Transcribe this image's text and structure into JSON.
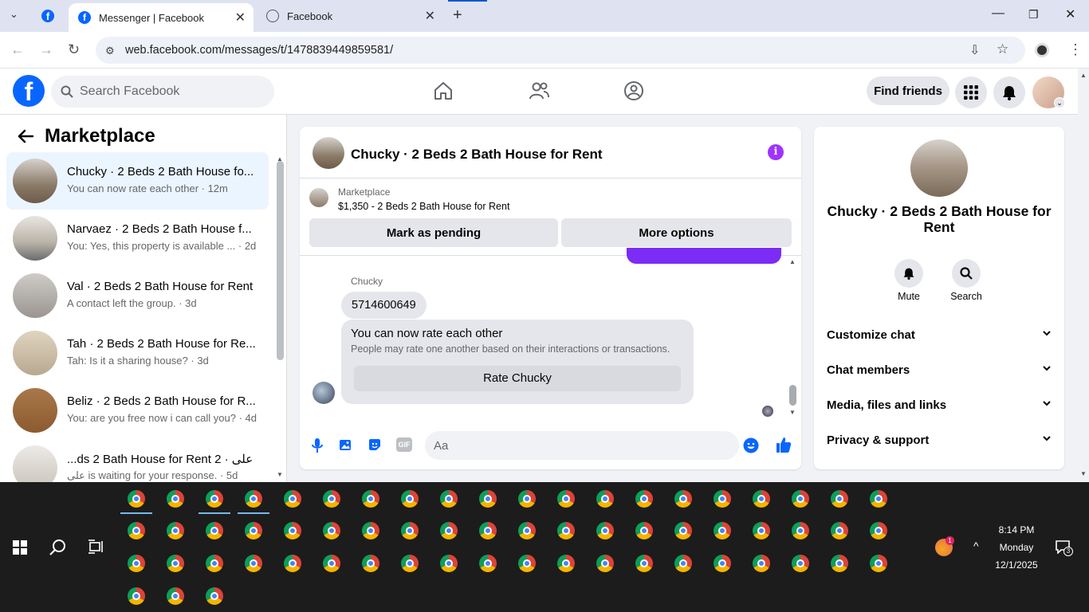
{
  "browser": {
    "tabs": [
      {
        "title": "Messenger | Facebook",
        "active": true
      },
      {
        "title": "Facebook",
        "active": false
      }
    ],
    "url": "web.facebook.com/messages/t/1478839449859581/"
  },
  "fb_header": {
    "logo_letter": "f",
    "search_placeholder": "Search Facebook",
    "find_friends_label": "Find friends"
  },
  "left_panel": {
    "title": "Marketplace",
    "chats": [
      {
        "name": "Chucky · 2 Beds 2 Bath House fo...",
        "preview": "You can now rate each other · 12m",
        "selected": true,
        "avatar_color": "#8a7a68"
      },
      {
        "name": "Narvaez · 2 Beds 2 Bath House f...",
        "preview": "You: Yes, this property is available ... · 2d",
        "selected": false,
        "avatar_color": "#b9b2a8"
      },
      {
        "name": "Val · 2 Beds 2 Bath House for Rent",
        "preview": "A contact left the group. · 3d",
        "selected": false,
        "avatar_color": "#9a9590"
      },
      {
        "name": "Tah · 2 Beds 2 Bath House for Re...",
        "preview": "Tah: Is it a sharing house? · 3d",
        "selected": false,
        "avatar_color": "#b8a890"
      },
      {
        "name": "Beliz · 2 Beds 2 Bath House for R...",
        "preview": "You: are you free now i can call you? · 4d",
        "selected": false,
        "avatar_color": "#8c5a2e"
      },
      {
        "name": "...ds 2 Bath House for Rent 2 · على",
        "preview": "على is waiting for your response. · 5d",
        "selected": false,
        "avatar_color": "#c9c4bb"
      }
    ]
  },
  "conversation": {
    "title": "Chucky · 2 Beds 2 Bath House for Rent",
    "listing_source": "Marketplace",
    "listing_summary": "$1,350 - 2 Beds 2 Bath House for Rent",
    "mark_pending_label": "Mark as pending",
    "more_options_label": "More options",
    "sender_name": "Chucky",
    "message_text": "5714600649",
    "rate_card_title": "You can now rate each other",
    "rate_card_body": "People may rate one another based on their interactions or transactions.",
    "rate_button_label": "Rate Chucky",
    "composer_placeholder": "Aa",
    "gif_label": "GIF"
  },
  "info_panel": {
    "name": "Chucky · 2 Beds 2 Bath House for Rent",
    "mute_label": "Mute",
    "search_label": "Search",
    "rows": [
      "Customize chat",
      "Chat members",
      "Media, files and links",
      "Privacy & support"
    ]
  },
  "taskbar": {
    "time": "8:14 PM",
    "day": "Monday",
    "date": "12/1/2025",
    "notification_count": "3",
    "tray_badge": "1"
  },
  "colors": {
    "fb_blue": "#0866ff",
    "messenger_purple": "#a033ff",
    "selected_chat_bg": "#ebf5ff"
  }
}
